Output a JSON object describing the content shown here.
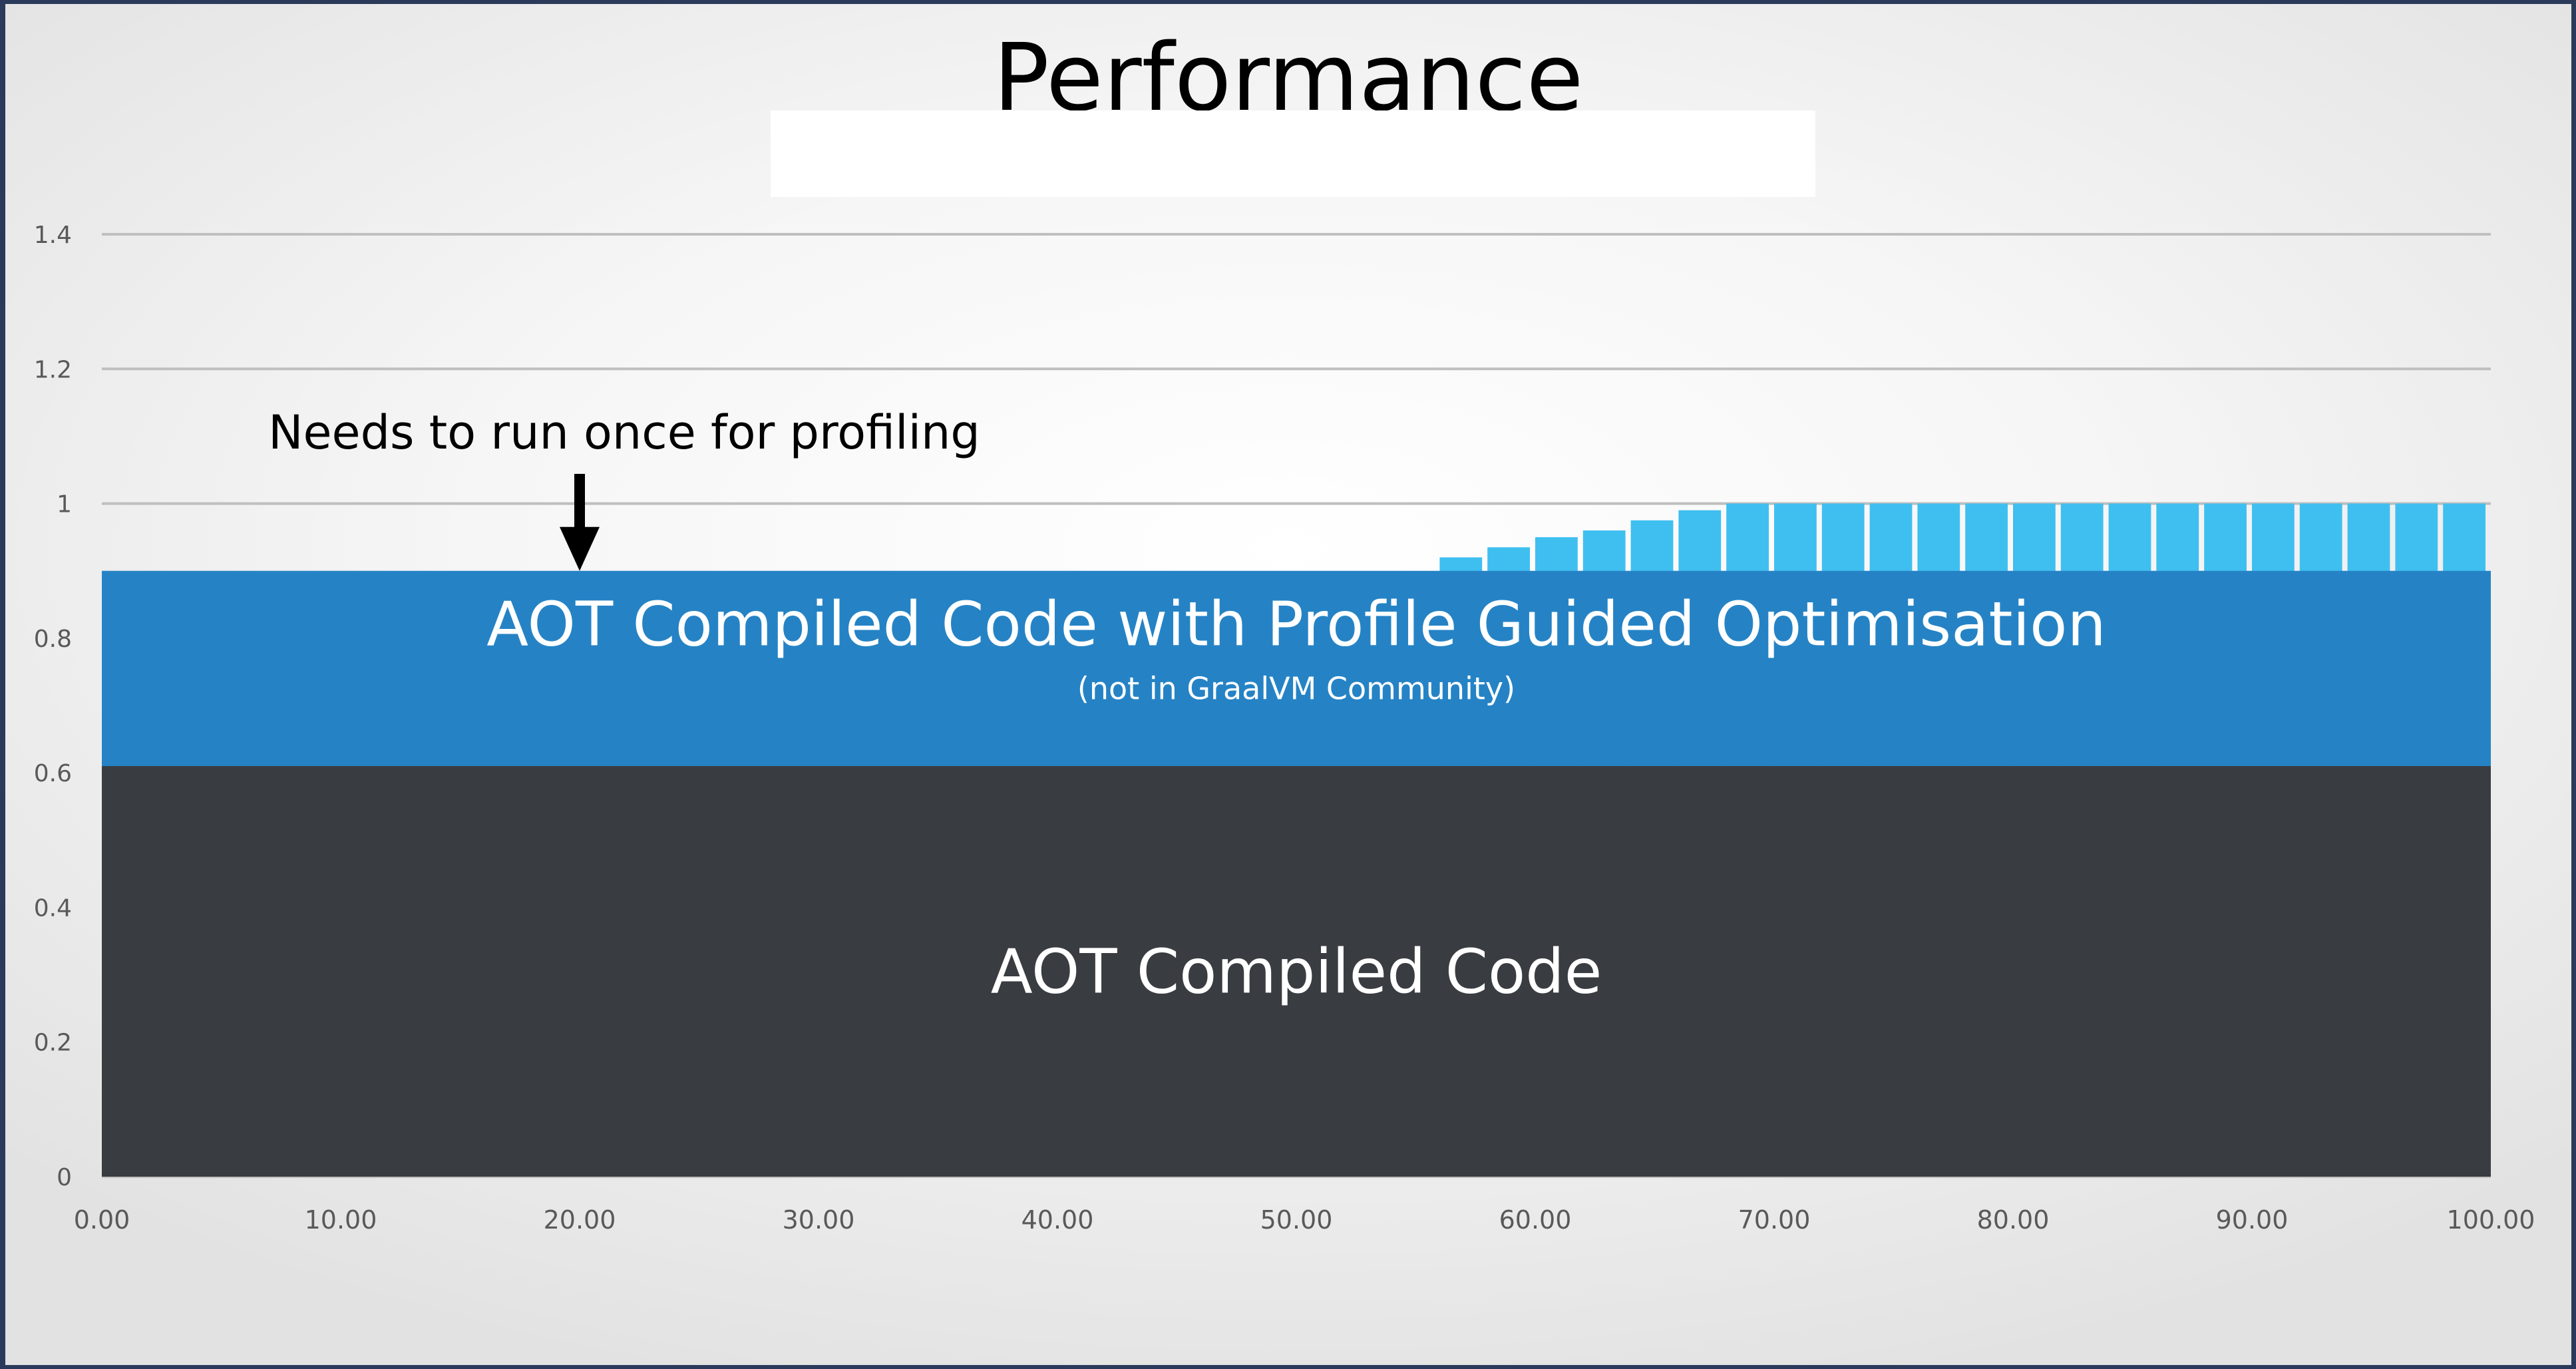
{
  "slide": {
    "title": "Performance"
  },
  "chart_data": {
    "type": "bar",
    "title": "Performance",
    "xlabel": "",
    "ylabel": "",
    "xlim": [
      0,
      100
    ],
    "ylim": [
      0,
      1.4
    ],
    "grid": true,
    "x_ticks": [
      "0.00",
      "10.00",
      "20.00",
      "30.00",
      "40.00",
      "50.00",
      "60.00",
      "70.00",
      "80.00",
      "90.00",
      "100.00"
    ],
    "y_ticks": [
      "0",
      "0.2",
      "0.4",
      "0.6",
      "0.8",
      "1",
      "1.2",
      "1.4"
    ],
    "x_tick_values": [
      0,
      10,
      20,
      30,
      40,
      50,
      60,
      70,
      80,
      90,
      100
    ],
    "y_tick_values": [
      0,
      0.2,
      0.4,
      0.6,
      0.8,
      1,
      1.2,
      1.4
    ],
    "series": [
      {
        "color": "#3fbff0",
        "x": [
          58,
          60,
          62,
          64,
          66,
          68,
          70,
          72,
          74,
          76,
          78,
          80,
          82,
          84,
          86,
          88,
          90,
          92,
          94,
          96,
          98,
          100
        ],
        "values": [
          0.92,
          0.935,
          0.95,
          0.96,
          0.975,
          0.99,
          1,
          1,
          1,
          1,
          1,
          1,
          1,
          1,
          1,
          1,
          1,
          1,
          1,
          1,
          1,
          1
        ]
      }
    ],
    "bands": [
      {
        "label": "AOT Compiled Code",
        "sublabel": "",
        "y_from": 0,
        "y_to": 0.61,
        "color": "#393c40"
      },
      {
        "label": "AOT Compiled Code with Profile Guided Optimisation",
        "sublabel": "(not in GraalVM Community)",
        "y_from": 0.61,
        "y_to": 0.9,
        "color": "#2583c5"
      }
    ],
    "annotation": {
      "text": "Needs to run once for profiling",
      "arrow_x": 20,
      "arrow_tip_y": 0.9
    }
  },
  "colors": {
    "grid": "#bfbfbf",
    "arrow": "#000000",
    "bar_gap": "#eeeeee"
  }
}
